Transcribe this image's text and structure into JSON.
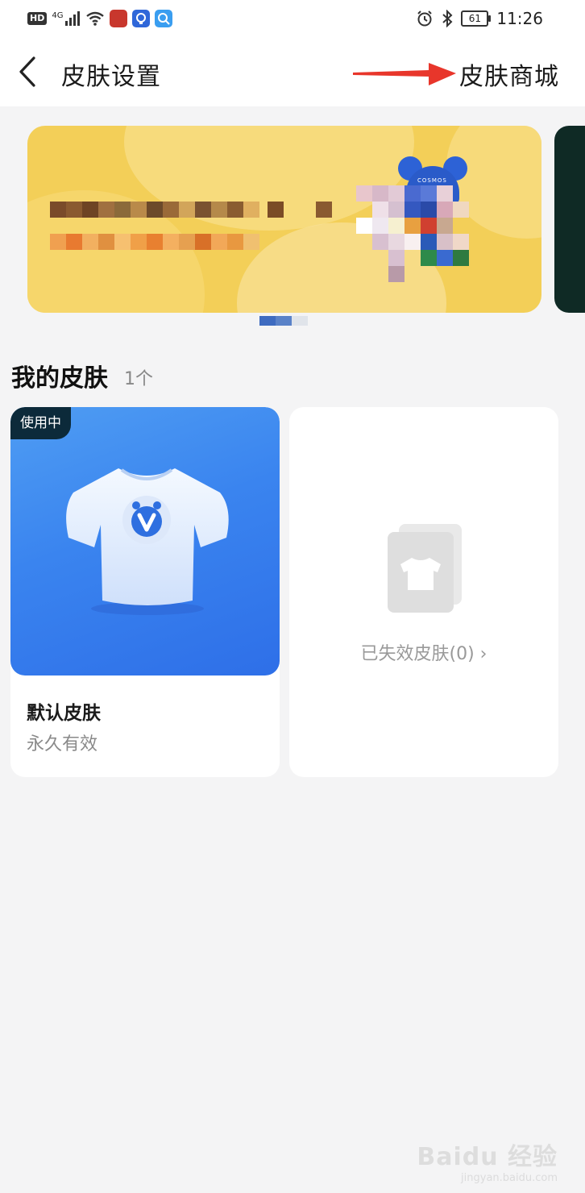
{
  "status_bar": {
    "hd": "HD",
    "network": "4G",
    "time": "11:26",
    "battery": "61"
  },
  "navbar": {
    "title": "皮肤设置",
    "shop_link": "皮肤商城"
  },
  "banner": {
    "mascot_text": "COSMOS",
    "active_index": 0
  },
  "my_skins": {
    "title": "我的皮肤",
    "count": "1个",
    "default_skin": {
      "badge": "使用中",
      "name": "默认皮肤",
      "validity": "永久有效"
    },
    "expired_link": "已失效皮肤(0) ›"
  },
  "watermark": {
    "main": "Baidu 经验",
    "sub": "jingyan.baidu.com"
  },
  "colors": {
    "accent_blue": "#3a84ef",
    "arrow_red": "#e8362b",
    "badge_dark": "#0c2a3a"
  }
}
